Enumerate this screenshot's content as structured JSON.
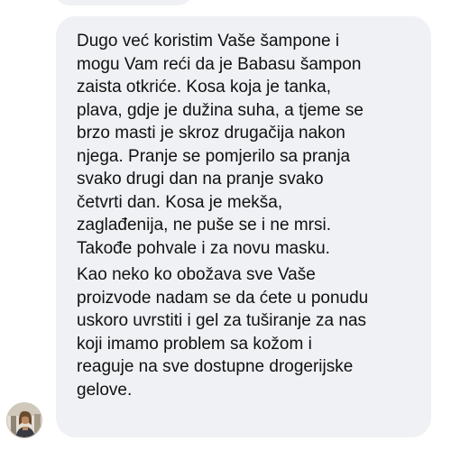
{
  "message": {
    "paragraphs": [
      "Dugo već koristim Vaše šampone i\nmogu Vam reći da je Babasu šampon\nzaista otkriće. Kosa koja je tanka,\nplava, gdje je dužina suha, a tjeme se\nbrzo masti je skroz drugačija nakon\nnjega. Pranje se pomjerilo sa pranja\nsvako drugi dan na pranje svako\nčetvrti dan. Kosa je mekša,\nzaglađenija, ne puše se i ne mrsi.\nTakođe pohvale i za novu masku.",
      "Kao neko ko obožava sve Vaše\nproizvode nadam se da ćete u ponudu\nuskoro uvrstiti i gel za tuširanje za nas\nkoji imamo problem sa kožom i\nreaguje na sve dostupne drogerijske\ngelove."
    ]
  },
  "colors": {
    "bubble_background": "#f0f1f4",
    "text": "#111111",
    "page_background": "#ffffff"
  },
  "icons": {
    "avatar": "user-photo"
  }
}
